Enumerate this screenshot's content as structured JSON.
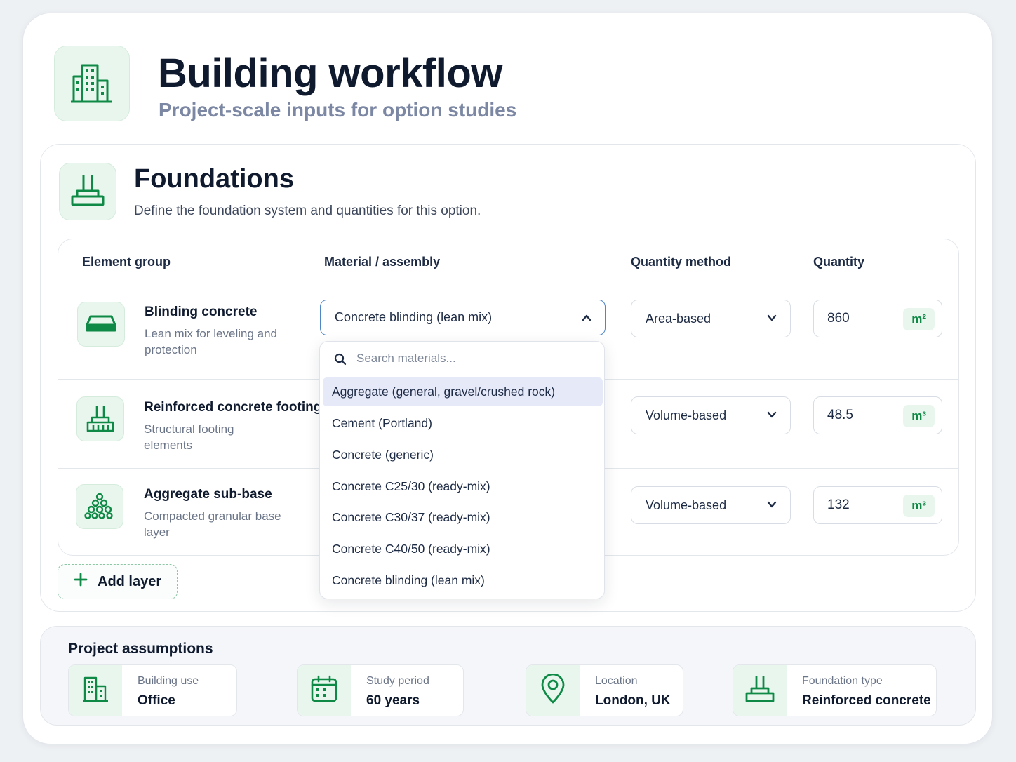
{
  "header": {
    "title": "Building workflow",
    "subtitle": "Project-scale inputs for option studies",
    "icon": "building-icon"
  },
  "section": {
    "title": "Foundations",
    "description": "Define the foundation system and quantities for this option.",
    "icon": "foundation-icon"
  },
  "table": {
    "columns": [
      "Element group",
      "Material / assembly",
      "Quantity method",
      "Quantity"
    ],
    "rows": [
      {
        "name": "Blinding concrete",
        "description": "Lean mix for leveling and protection",
        "icon": "slab-icon",
        "material": "Concrete blinding (lean mix)",
        "method": "Area-based",
        "quantity": "860",
        "unit": "m²"
      },
      {
        "name": "Reinforced concrete footing",
        "description": "Structural footing elements",
        "icon": "footing-icon",
        "method": "Volume-based",
        "quantity": "48.5",
        "unit": "m³"
      },
      {
        "name": "Aggregate sub-base",
        "description": "Compacted granular base layer",
        "icon": "aggregate-icon",
        "method": "Volume-based",
        "quantity": "132",
        "unit": "m³"
      }
    ]
  },
  "dropdown": {
    "search_placeholder": "Search materials...",
    "options": [
      "Aggregate (general, gravel/crushed rock)",
      "Cement (Portland)",
      "Concrete (generic)",
      "Concrete C25/30 (ready-mix)",
      "Concrete C30/37 (ready-mix)",
      "Concrete C40/50 (ready-mix)",
      "Concrete blinding (lean mix)"
    ],
    "highlighted_index": 0
  },
  "add_layer_label": "Add layer",
  "assumptions": {
    "title": "Project assumptions",
    "items": [
      {
        "label": "Building use",
        "value": "Office",
        "icon": "building-icon"
      },
      {
        "label": "Study period",
        "value": "60 years",
        "icon": "calendar-icon"
      },
      {
        "label": "Location",
        "value": "London, UK",
        "icon": "location-pin-icon"
      },
      {
        "label": "Foundation type",
        "value": "Reinforced concrete",
        "icon": "foundation-icon"
      }
    ]
  },
  "colors": {
    "accent_green": "#0f8a46",
    "icon_tile_bg": "#e9f6ee",
    "highlight": "#e6e9f8",
    "focus_border": "#4f86c6"
  }
}
